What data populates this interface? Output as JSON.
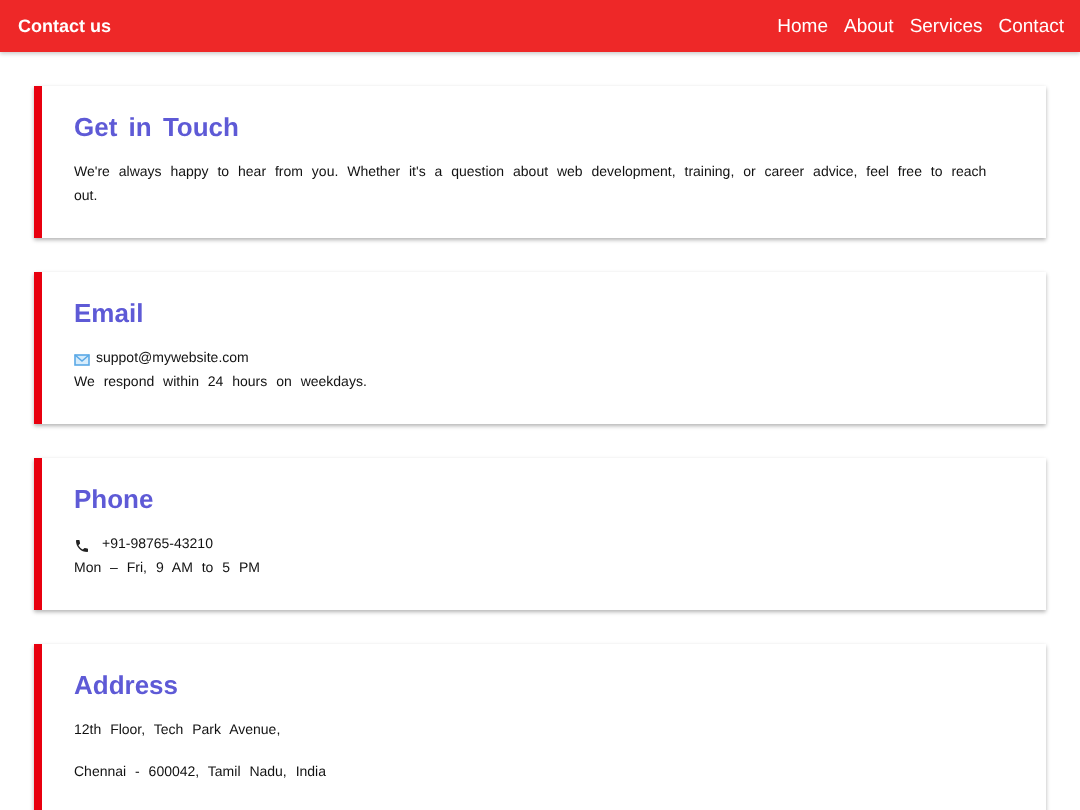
{
  "navbar": {
    "title": "Contact us",
    "links": [
      "Home",
      "About",
      "Services",
      "Contact"
    ]
  },
  "cards": [
    {
      "heading": "Get  in  Touch",
      "lines": [
        {
          "kind": "paragraph",
          "text": "We're always happy to hear from you. Whether it's a question about web development, training, or career advice, feel free to reach out."
        }
      ]
    },
    {
      "heading": "Email",
      "lines": [
        {
          "kind": "email",
          "text": "suppot@mywebsite.com"
        },
        {
          "kind": "line",
          "text": "We respond within 24 hours on weekdays."
        }
      ]
    },
    {
      "heading": "Phone",
      "lines": [
        {
          "kind": "phone",
          "text": "+91-98765-43210"
        },
        {
          "kind": "line",
          "text": "Mon – Fri, 9 AM to 5 PM"
        }
      ]
    },
    {
      "heading": "Address",
      "lines": [
        {
          "kind": "paragraph",
          "text": "12th Floor, Tech Park Avenue,"
        },
        {
          "kind": "paragraph",
          "text": "Chennai - 600042, Tamil Nadu, India"
        }
      ]
    }
  ]
}
